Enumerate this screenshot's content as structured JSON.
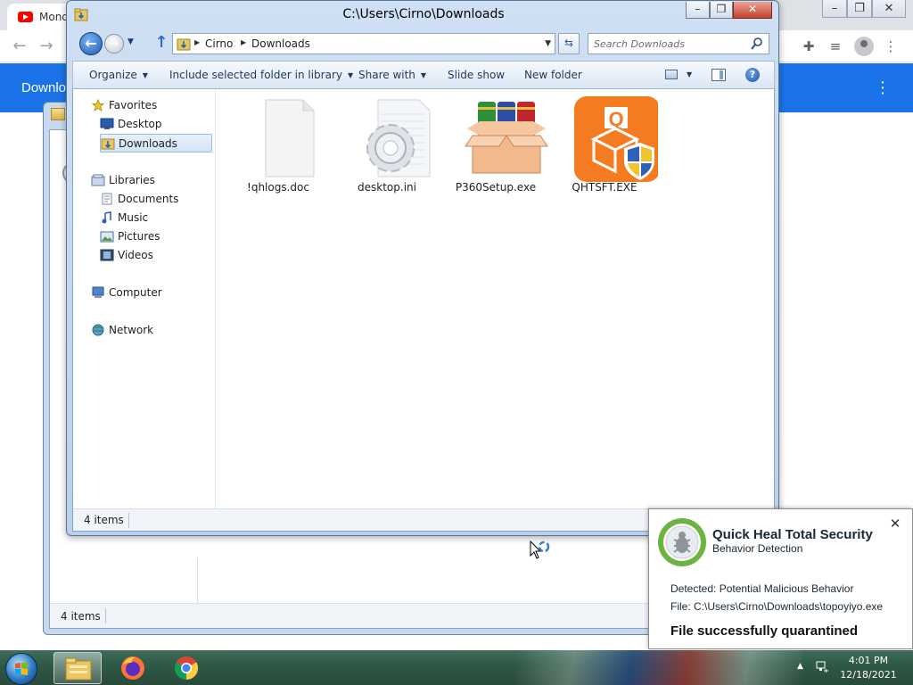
{
  "browser": {
    "tab_title": "Mond",
    "header_title": "Downlo",
    "colors": {
      "header": "#1a73e8",
      "tabstrip": "#dee1e6"
    }
  },
  "explorer_back": {
    "status_items": "4 items"
  },
  "explorer": {
    "title": "C:\\Users\\Cirno\\Downloads",
    "breadcrumb": [
      "Cirno",
      "Downloads"
    ],
    "search_placeholder": "Search Downloads",
    "commands": {
      "organize": "Organize",
      "include": "Include selected folder in library",
      "share": "Share with",
      "slideshow": "Slide show",
      "new_folder": "New folder"
    },
    "nav": {
      "favorites": "Favorites",
      "desktop": "Desktop",
      "downloads": "Downloads",
      "libraries": "Libraries",
      "documents": "Documents",
      "music": "Music",
      "pictures": "Pictures",
      "videos": "Videos",
      "computer": "Computer",
      "network": "Network"
    },
    "files": [
      {
        "name": "!qhlogs.doc",
        "icon": "blank-document-icon"
      },
      {
        "name": "desktop.ini",
        "icon": "settings-file-icon"
      },
      {
        "name": "P360Setup.exe",
        "icon": "installer-box-icon"
      },
      {
        "name": "QHTSFT.EXE",
        "icon": "quick-heal-shield-icon"
      }
    ],
    "status_items": "4 items"
  },
  "notification": {
    "title": "Quick Heal Total Security",
    "subtitle": "Behavior Detection",
    "detected": "Detected: Potential Malicious Behavior",
    "file": "File: C:\\Users\\Cirno\\Downloads\\topoyiyo.exe",
    "result": "File successfully quarantined",
    "colors": {
      "ring": "#6cb33f"
    }
  },
  "taskbar": {
    "time": "4:01 PM",
    "date": "12/18/2021",
    "apps": [
      "windows-explorer-icon",
      "firefox-icon",
      "chrome-icon"
    ]
  }
}
